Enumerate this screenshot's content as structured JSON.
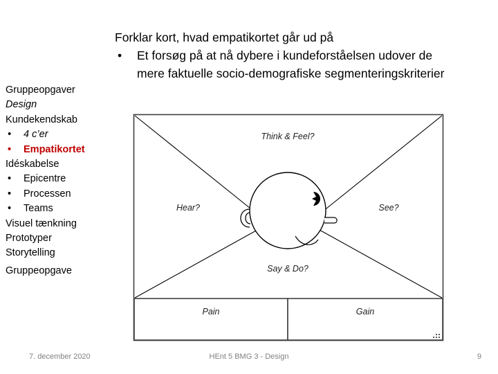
{
  "slide": {
    "headline": {
      "title": "Forklar kort, hvad empatikortet går ud på",
      "bullet_marker": "•",
      "bullet_text": "Et forsøg på at nå dybere i kundeforståelsen udover de mere faktuelle socio-demografiske segmenteringskriterier"
    },
    "accent_color": "#C00000",
    "footer": {
      "date": "7. december 2020",
      "center": "HEnt 5 BMG 3 -  Design",
      "page_number": "9"
    }
  },
  "sidebar": {
    "items": [
      {
        "label": "Gruppeopgaver",
        "style": "plain",
        "bullet": ""
      },
      {
        "label": "Design",
        "style": "italic",
        "bullet": ""
      },
      {
        "label": "Kundekendskab",
        "style": "plain",
        "bullet": ""
      },
      {
        "label": "4 c’er",
        "style": "italic",
        "bullet": "•"
      },
      {
        "label": "Empatikortet",
        "style": "accent",
        "bullet": "•"
      },
      {
        "label": "Idéskabelse",
        "style": "plain",
        "bullet": ""
      },
      {
        "label": "Epicentre",
        "style": "plain",
        "bullet": "•"
      },
      {
        "label": "Processen",
        "style": "plain",
        "bullet": "•"
      },
      {
        "label": "Teams",
        "style": "plain",
        "bullet": "•"
      },
      {
        "label": "Visuel tænkning",
        "style": "plain",
        "bullet": ""
      },
      {
        "label": "Prototyper",
        "style": "plain",
        "bullet": ""
      },
      {
        "label": "Storytelling",
        "style": "plain",
        "bullet": ""
      },
      {
        "label": "Gruppeopgave",
        "style": "plain",
        "bullet": ""
      }
    ]
  },
  "empathy_map": {
    "quadrant_labels": {
      "top": "Think & Feel?",
      "left": "Hear?",
      "right": "See?",
      "bottom": "Say & Do?"
    },
    "bottom_boxes": [
      {
        "label": "Pain"
      },
      {
        "label": "Gain"
      }
    ],
    "stroke_color": "#000000",
    "fill_color": "#ffffff"
  }
}
